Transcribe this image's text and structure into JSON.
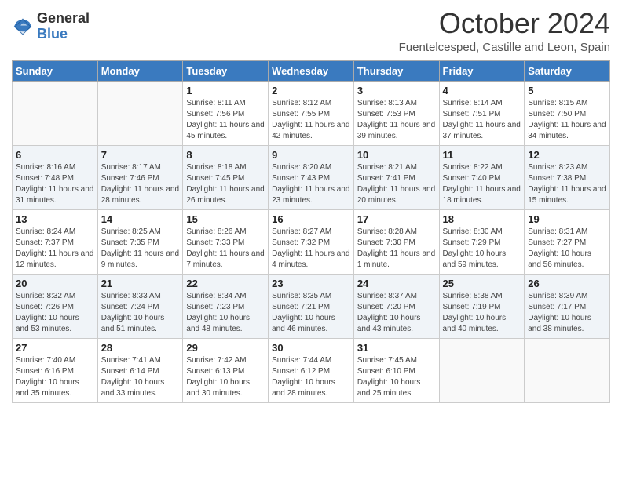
{
  "header": {
    "logo_general": "General",
    "logo_blue": "Blue",
    "month_title": "October 2024",
    "subtitle": "Fuentelcesped, Castille and Leon, Spain"
  },
  "weekdays": [
    "Sunday",
    "Monday",
    "Tuesday",
    "Wednesday",
    "Thursday",
    "Friday",
    "Saturday"
  ],
  "weeks": [
    [
      {
        "day": "",
        "info": ""
      },
      {
        "day": "",
        "info": ""
      },
      {
        "day": "1",
        "info": "Sunrise: 8:11 AM\nSunset: 7:56 PM\nDaylight: 11 hours and 45 minutes."
      },
      {
        "day": "2",
        "info": "Sunrise: 8:12 AM\nSunset: 7:55 PM\nDaylight: 11 hours and 42 minutes."
      },
      {
        "day": "3",
        "info": "Sunrise: 8:13 AM\nSunset: 7:53 PM\nDaylight: 11 hours and 39 minutes."
      },
      {
        "day": "4",
        "info": "Sunrise: 8:14 AM\nSunset: 7:51 PM\nDaylight: 11 hours and 37 minutes."
      },
      {
        "day": "5",
        "info": "Sunrise: 8:15 AM\nSunset: 7:50 PM\nDaylight: 11 hours and 34 minutes."
      }
    ],
    [
      {
        "day": "6",
        "info": "Sunrise: 8:16 AM\nSunset: 7:48 PM\nDaylight: 11 hours and 31 minutes."
      },
      {
        "day": "7",
        "info": "Sunrise: 8:17 AM\nSunset: 7:46 PM\nDaylight: 11 hours and 28 minutes."
      },
      {
        "day": "8",
        "info": "Sunrise: 8:18 AM\nSunset: 7:45 PM\nDaylight: 11 hours and 26 minutes."
      },
      {
        "day": "9",
        "info": "Sunrise: 8:20 AM\nSunset: 7:43 PM\nDaylight: 11 hours and 23 minutes."
      },
      {
        "day": "10",
        "info": "Sunrise: 8:21 AM\nSunset: 7:41 PM\nDaylight: 11 hours and 20 minutes."
      },
      {
        "day": "11",
        "info": "Sunrise: 8:22 AM\nSunset: 7:40 PM\nDaylight: 11 hours and 18 minutes."
      },
      {
        "day": "12",
        "info": "Sunrise: 8:23 AM\nSunset: 7:38 PM\nDaylight: 11 hours and 15 minutes."
      }
    ],
    [
      {
        "day": "13",
        "info": "Sunrise: 8:24 AM\nSunset: 7:37 PM\nDaylight: 11 hours and 12 minutes."
      },
      {
        "day": "14",
        "info": "Sunrise: 8:25 AM\nSunset: 7:35 PM\nDaylight: 11 hours and 9 minutes."
      },
      {
        "day": "15",
        "info": "Sunrise: 8:26 AM\nSunset: 7:33 PM\nDaylight: 11 hours and 7 minutes."
      },
      {
        "day": "16",
        "info": "Sunrise: 8:27 AM\nSunset: 7:32 PM\nDaylight: 11 hours and 4 minutes."
      },
      {
        "day": "17",
        "info": "Sunrise: 8:28 AM\nSunset: 7:30 PM\nDaylight: 11 hours and 1 minute."
      },
      {
        "day": "18",
        "info": "Sunrise: 8:30 AM\nSunset: 7:29 PM\nDaylight: 10 hours and 59 minutes."
      },
      {
        "day": "19",
        "info": "Sunrise: 8:31 AM\nSunset: 7:27 PM\nDaylight: 10 hours and 56 minutes."
      }
    ],
    [
      {
        "day": "20",
        "info": "Sunrise: 8:32 AM\nSunset: 7:26 PM\nDaylight: 10 hours and 53 minutes."
      },
      {
        "day": "21",
        "info": "Sunrise: 8:33 AM\nSunset: 7:24 PM\nDaylight: 10 hours and 51 minutes."
      },
      {
        "day": "22",
        "info": "Sunrise: 8:34 AM\nSunset: 7:23 PM\nDaylight: 10 hours and 48 minutes."
      },
      {
        "day": "23",
        "info": "Sunrise: 8:35 AM\nSunset: 7:21 PM\nDaylight: 10 hours and 46 minutes."
      },
      {
        "day": "24",
        "info": "Sunrise: 8:37 AM\nSunset: 7:20 PM\nDaylight: 10 hours and 43 minutes."
      },
      {
        "day": "25",
        "info": "Sunrise: 8:38 AM\nSunset: 7:19 PM\nDaylight: 10 hours and 40 minutes."
      },
      {
        "day": "26",
        "info": "Sunrise: 8:39 AM\nSunset: 7:17 PM\nDaylight: 10 hours and 38 minutes."
      }
    ],
    [
      {
        "day": "27",
        "info": "Sunrise: 7:40 AM\nSunset: 6:16 PM\nDaylight: 10 hours and 35 minutes."
      },
      {
        "day": "28",
        "info": "Sunrise: 7:41 AM\nSunset: 6:14 PM\nDaylight: 10 hours and 33 minutes."
      },
      {
        "day": "29",
        "info": "Sunrise: 7:42 AM\nSunset: 6:13 PM\nDaylight: 10 hours and 30 minutes."
      },
      {
        "day": "30",
        "info": "Sunrise: 7:44 AM\nSunset: 6:12 PM\nDaylight: 10 hours and 28 minutes."
      },
      {
        "day": "31",
        "info": "Sunrise: 7:45 AM\nSunset: 6:10 PM\nDaylight: 10 hours and 25 minutes."
      },
      {
        "day": "",
        "info": ""
      },
      {
        "day": "",
        "info": ""
      }
    ]
  ]
}
